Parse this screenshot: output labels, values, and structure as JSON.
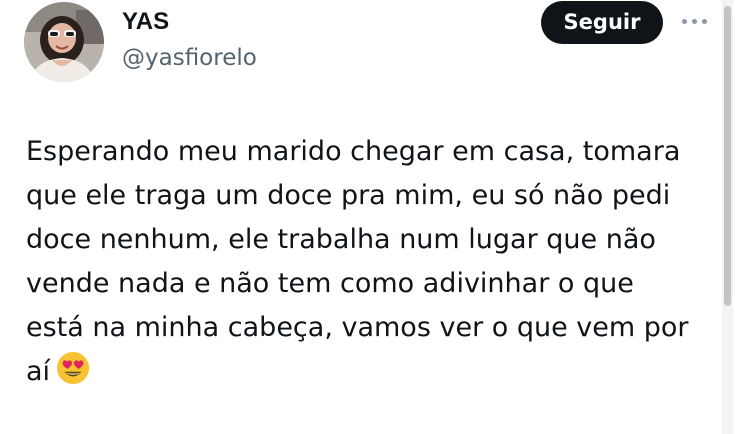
{
  "author": {
    "display_name": "YAS",
    "handle": "@yasfiorelo"
  },
  "actions": {
    "follow_label": "Seguir",
    "more_icon": "more-horizontal-icon"
  },
  "tweet": {
    "lines": [
      "Esperando meu marido chegar em casa, tomara",
      "que ele traga um doce pra mim, eu só não pedi",
      "doce nenhum, ele trabalha num lugar que não",
      "vende nada e não tem como adivinhar o que",
      "está na minha cabeça, vamos ver o que vem por",
      "aí"
    ],
    "emoji": "heart-eyes-emoji"
  },
  "colors": {
    "text": "#0f1419",
    "secondary": "#536471",
    "button_bg": "#0f1419",
    "button_text": "#ffffff"
  }
}
